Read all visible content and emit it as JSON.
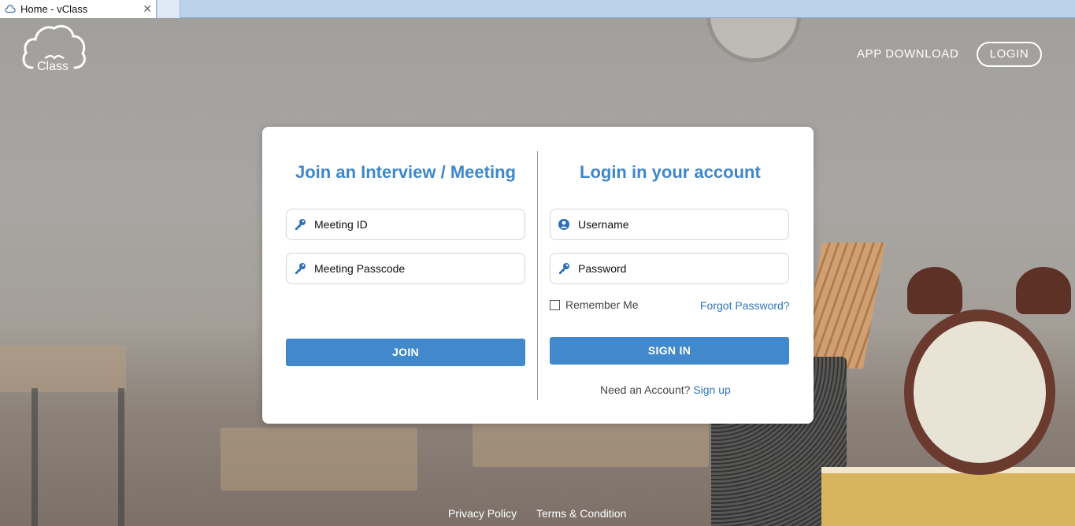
{
  "browser": {
    "tab_title": "Home - vClass",
    "close_glyph": "✕"
  },
  "header": {
    "logo_text": "Class",
    "app_download": "APP DOWNLOAD",
    "login": "LOGIN"
  },
  "join_panel": {
    "title": "Join an Interview / Meeting",
    "meeting_id_placeholder": "Meeting ID",
    "meeting_passcode_placeholder": "Meeting Passcode",
    "join_button": "JOIN",
    "icon": "key-icon"
  },
  "login_panel": {
    "title": "Login in your account",
    "username_placeholder": "Username",
    "password_placeholder": "Password",
    "remember_me": "Remember Me",
    "forgot_password": "Forgot Password?",
    "sign_in_button": "SIGN IN",
    "need_account": "Need an Account?",
    "sign_up": "Sign up",
    "user_icon": "user-circle-icon",
    "password_icon": "key-icon"
  },
  "footer": {
    "privacy": "Privacy Policy",
    "terms": "Terms & Condition"
  },
  "colors": {
    "accent": "#4189cc",
    "title": "#3e87c8",
    "link": "#2f73b8"
  }
}
